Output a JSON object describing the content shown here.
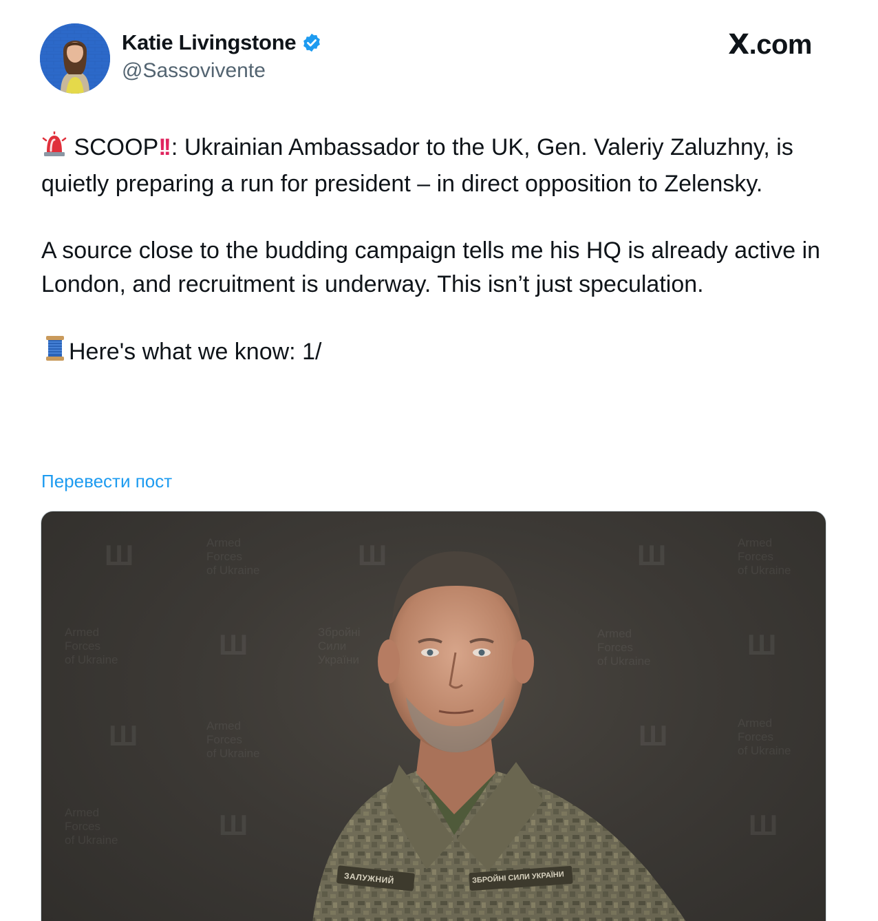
{
  "brand": {
    "label": "X.com"
  },
  "author": {
    "name": "Katie Livingstone",
    "handle": "@Sassovivente",
    "verified": true
  },
  "tweet": {
    "paragraph1_scoop": "SCOOP",
    "paragraph1_rest": ": Ukrainian Ambassador to the UK, Gen. Valeriy Zaluzhny, is quietly preparing a run for president – in direct opposition to Zelensky.",
    "paragraph2": "A source close to the budding campaign tells me his HQ is already active in London, and recruitment is underway. This isn’t just speculation.",
    "paragraph3": "Here's what we know: 1/",
    "emoji1": "siren",
    "emoji2": "double-exclamation",
    "emoji3": "spool-of-thread"
  },
  "translate_label": "Перевести пост",
  "media": {
    "watermark_en": [
      "Armed",
      "Forces",
      "of Ukraine"
    ],
    "watermark_ua": [
      "Збройні",
      "Сили",
      "України"
    ],
    "name_tag": "ЗАЛУЖНИЙ",
    "unit_tag": "ЗБРОЙНІ СИЛИ УКРАЇНИ"
  },
  "colors": {
    "accent": "#1d9bf0",
    "text": "#0f1419",
    "secondary": "#536471",
    "media_bg": "#3c3935"
  }
}
